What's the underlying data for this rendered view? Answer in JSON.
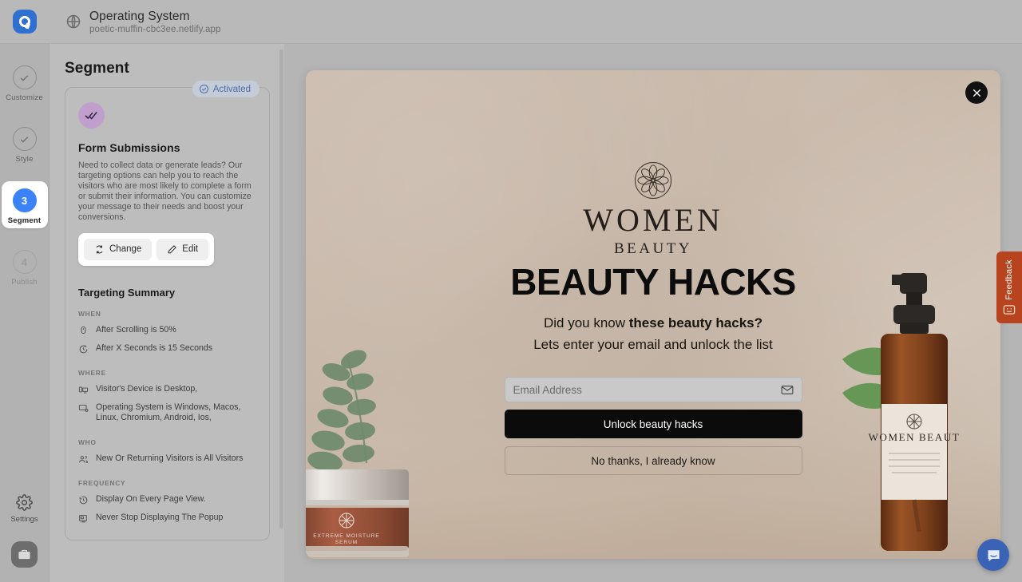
{
  "header": {
    "site_title": "Operating System",
    "site_url": "poetic-muffin-cbc3ee.netlify.app",
    "logo_name": "popupsmart-logo",
    "globe_icon": "globe-icon"
  },
  "rail": {
    "steps": [
      {
        "label": "Customize",
        "marker": "check",
        "state": "done"
      },
      {
        "label": "Style",
        "marker": "check",
        "state": "done"
      },
      {
        "label": "Segment",
        "marker": "3",
        "state": "active"
      },
      {
        "label": "Publish",
        "marker": "4",
        "state": "future"
      }
    ],
    "settings_label": "Settings",
    "settings_icon": "gear-icon",
    "workspace_icon": "briefcase-icon"
  },
  "panel": {
    "title": "Segment",
    "badge": "Activated",
    "badge_icon": "check-circle-icon",
    "card_icon": "double-check-icon",
    "card_title": "Form Submissions",
    "card_desc": "Need to collect data or generate leads? Our targeting options can help you to reach the visitors who are most likely to complete a form or submit their information. You can customize your message to their needs and boost your conversions.",
    "change_label": "Change",
    "change_icon": "refresh-icon",
    "edit_label": "Edit",
    "edit_icon": "pencil-icon",
    "summary_title": "Targeting Summary",
    "groups": [
      {
        "label": "WHEN",
        "rows": [
          {
            "icon": "mouse-scroll-icon",
            "text": "After Scrolling is 50%"
          },
          {
            "icon": "timer-icon",
            "text": "After X Seconds is 15 Seconds"
          }
        ]
      },
      {
        "label": "WHERE",
        "rows": [
          {
            "icon": "devices-icon",
            "text": "Visitor's Device is Desktop,"
          },
          {
            "icon": "monitor-os-icon",
            "text": "Operating System is Windows, Macos, Linux, Chromium, Android, Ios,"
          }
        ]
      },
      {
        "label": "WHO",
        "rows": [
          {
            "icon": "users-icon",
            "text": "New Or Returning Visitors is All Visitors"
          }
        ]
      },
      {
        "label": "FREQUENCY",
        "rows": [
          {
            "icon": "clock-history-icon",
            "text": "Display On Every Page View."
          },
          {
            "icon": "popup-screen-icon",
            "text": "Never Stop Displaying The Popup"
          }
        ]
      }
    ]
  },
  "preview": {
    "close_icon": "close-icon",
    "brand_mark_icon": "flower-mandala-icon",
    "brand_line1": "WOMEN",
    "brand_line2": "BEAUTY",
    "headline": "BEAUTY HACKS",
    "sub_line1_prefix": "Did you know ",
    "sub_line1_strong": "these beauty hacks?",
    "sub_line2": "Lets enter your email and unlock the list",
    "email_placeholder": "Email Address",
    "email_value": "",
    "email_icon": "envelope-icon",
    "cta_label": "Unlock beauty hacks",
    "dismiss_label": "No thanks, I already know",
    "jar_label_line1": "EXTREME MOISTURE",
    "jar_label_line2": "SERUM",
    "bottle_label": "WOMEN BEAUTY"
  },
  "widgets": {
    "feedback_label": "Feedback",
    "feedback_icon": "smiley-box-icon",
    "chat_icon": "chat-bubble-icon"
  },
  "colors": {
    "accent_blue": "#3b82f6",
    "badge_blue": "#4b6ea8",
    "card_icon_purple": "#c09fcd",
    "feedback_orange": "#b8441f",
    "chat_blue": "#3b63b5",
    "popup_bg": "#c9bbac"
  }
}
